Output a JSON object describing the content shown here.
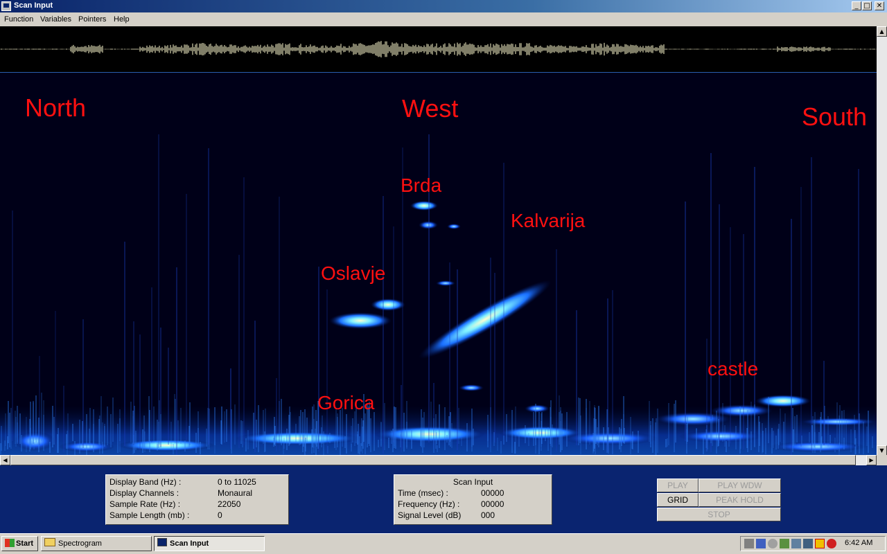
{
  "window": {
    "title": "Scan Input",
    "min": "_",
    "max": "□",
    "close": "✕"
  },
  "menu": {
    "items": [
      "Function",
      "Variables",
      "Pointers",
      "Help"
    ]
  },
  "spectrogram": {
    "labels": {
      "north": "North",
      "west": "West",
      "south": "South",
      "brda": "Brda",
      "kalvarija": "Kalvarija",
      "oslavje": "Oslavje",
      "castle": "castle",
      "gorica": "Gorica"
    }
  },
  "settings": {
    "rows": [
      {
        "label": "Display Band (Hz) :",
        "value": "0 to 11025"
      },
      {
        "label": "Display Channels :",
        "value": "Monaural"
      },
      {
        "label": "Sample Rate (Hz) :",
        "value": "22050"
      },
      {
        "label": "Sample Length (mb) :",
        "value": "0"
      }
    ]
  },
  "scan": {
    "title": "Scan Input",
    "rows": [
      {
        "label": "Time (msec) :",
        "value": "00000"
      },
      {
        "label": "Frequency (Hz) :",
        "value": "00000"
      },
      {
        "label": "Signal Level (dB)",
        "value": "000"
      }
    ]
  },
  "controls": {
    "play": "PLAY",
    "play_wdw": "PLAY WDW",
    "grid": "GRID",
    "peak_hold": "PEAK HOLD",
    "stop": "STOP"
  },
  "taskbar": {
    "start": "Start",
    "tasks": [
      "Spectrogram",
      "Scan Input"
    ],
    "clock": "6:42 AM"
  },
  "colors": {
    "label_red": "#ff1010",
    "panel_blue": "#0a2470",
    "spectrum_hot": "#9ef0ff",
    "spectrum_cold": "#1040d0"
  }
}
